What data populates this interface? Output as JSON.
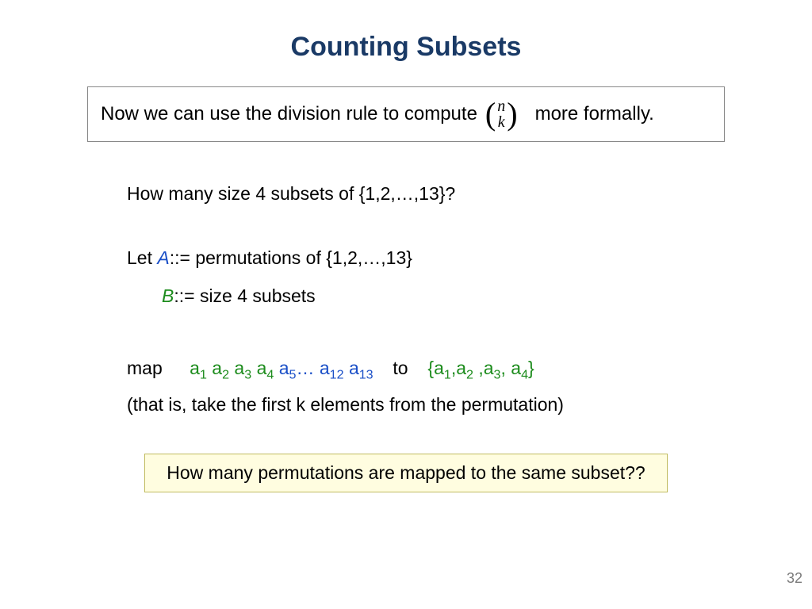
{
  "title": "Counting Subsets",
  "intro": {
    "before": "Now we can use the division rule to compute",
    "binom_top": "n",
    "binom_bottom": "k",
    "after": "more formally."
  },
  "q1": "How many size 4 subsets of {1,2,…,13}?",
  "letA": {
    "pre": "Let ",
    "var": "A",
    "rest": "::= permutations of {1,2,…,13}"
  },
  "letB": {
    "var": "B",
    "rest": "::= size 4 subsets"
  },
  "map": {
    "label": "map",
    "g_a1": "a",
    "g_s1": "1",
    "g_a2": "a",
    "g_s2": "2",
    "g_a3": "a",
    "g_s3": "3",
    "g_a4": "a",
    "g_s4": "4",
    "b_a5": "a",
    "b_s5": "5",
    "b_dots": "…",
    "b_a12": "a",
    "b_s12": "12",
    "b_a13": "a",
    "b_s13": "13",
    "to": "to",
    "set_open": "{",
    "r_a1": "a",
    "r_s1": "1",
    "c1": ",",
    "r_a2": "a",
    "r_s2": "2",
    "c2": " ,",
    "r_a3": "a",
    "r_s3": "3",
    "c3": ", ",
    "r_a4": "a",
    "r_s4": "4",
    "set_close": "}"
  },
  "explain": "(that is, take the first k elements from the permutation)",
  "question": "How many permutations are mapped to the same subset??",
  "page": "32"
}
